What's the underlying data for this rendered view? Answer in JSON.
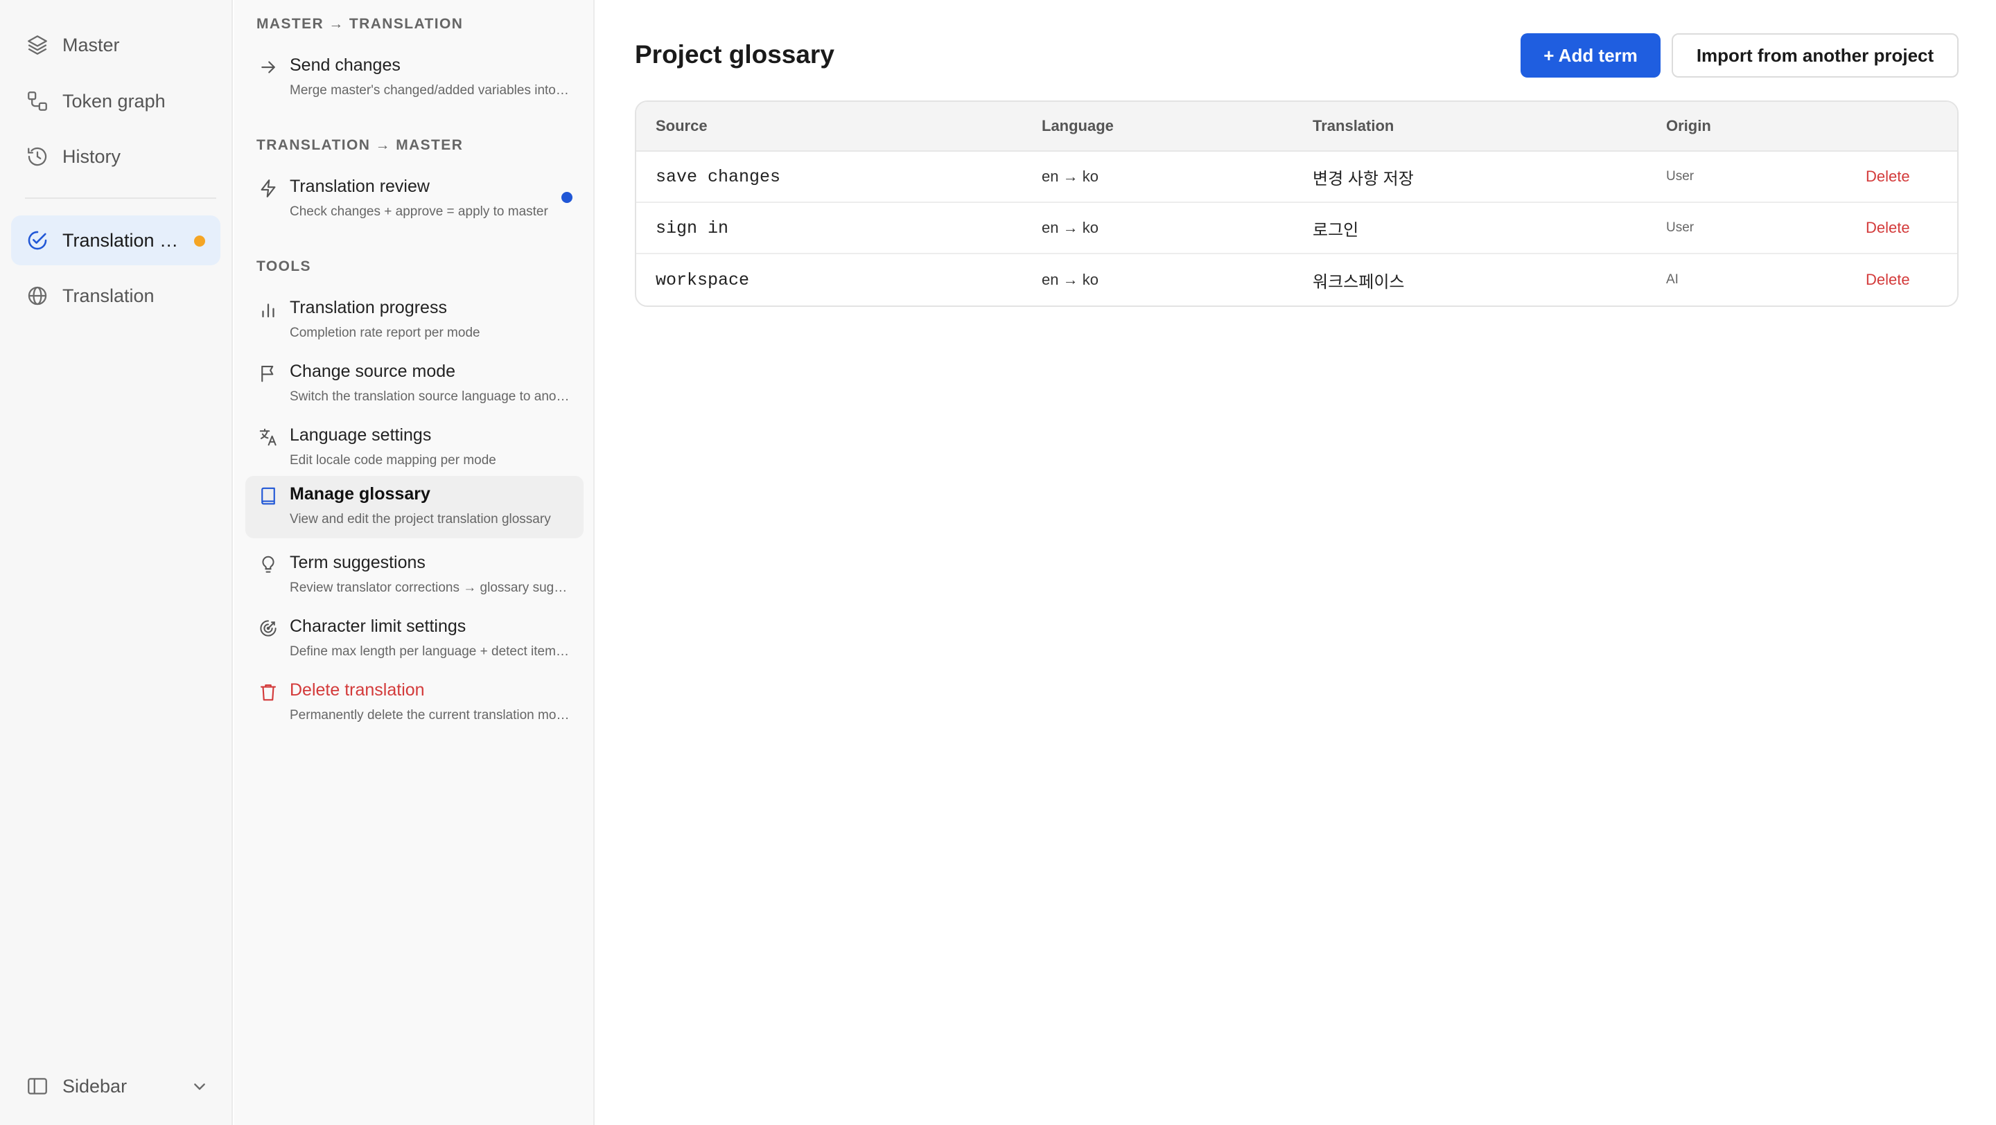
{
  "nav": {
    "items": [
      {
        "label": "Master",
        "icon": "layers-icon"
      },
      {
        "label": "Token graph",
        "icon": "graph-icon"
      },
      {
        "label": "History",
        "icon": "history-icon"
      },
      {
        "label": "Translation review",
        "icon": "check-circle-icon"
      },
      {
        "label": "Translation",
        "icon": "globe-icon"
      }
    ],
    "bottom_label": "Sidebar",
    "colors": {
      "active_bg": "#e6effb",
      "badge": "#f5a524"
    }
  },
  "panel": {
    "sections": [
      {
        "title": "MASTER → TRANSLATION"
      },
      {
        "title": "TRANSLATION → MASTER"
      },
      {
        "title": "TOOLS"
      }
    ],
    "tools": [
      {
        "title": "Send changes",
        "desc": "Merge master's changed/added variables into translation",
        "icon": "arrow-right-icon"
      },
      {
        "title": "Translation review",
        "desc": "Check changes + approve = apply to master",
        "icon": "lightning-icon"
      },
      {
        "title": "Translation progress",
        "desc": "Completion rate report per mode",
        "icon": "bar-chart-icon"
      },
      {
        "title": "Change source mode",
        "desc": "Switch the translation source language to another mode",
        "icon": "flag-icon"
      },
      {
        "title": "Language settings",
        "desc": "Edit locale code mapping per mode",
        "icon": "translate-icon"
      },
      {
        "title": "Manage glossary",
        "desc": "View and edit the project translation glossary",
        "icon": "book-icon"
      },
      {
        "title": "Term suggestions",
        "desc": "Review translator corrections → glossary suggestions",
        "icon": "lightbulb-icon"
      },
      {
        "title": "Character limit settings",
        "desc": "Define max length per language + detect items over limit",
        "icon": "target-icon"
      },
      {
        "title": "Delete translation",
        "desc": "Permanently delete the current translation mode",
        "icon": "trash-icon"
      }
    ],
    "colors": {
      "danger": "#d33a3a",
      "dot": "#2157d6"
    }
  },
  "main": {
    "title": "Project glossary",
    "add_label": "+ Add term",
    "import_label": "Import from another project",
    "colors": {
      "primary": "#1f5ee0"
    },
    "table": {
      "columns": [
        "Source",
        "Language",
        "Translation",
        "Origin"
      ],
      "rows": [
        {
          "source": "save changes",
          "language": "en → ko",
          "translation": "변경 사항 저장",
          "origin": "User",
          "action": "Delete"
        },
        {
          "source": "sign in",
          "language": "en → ko",
          "translation": "로그인",
          "origin": "User",
          "action": "Delete"
        },
        {
          "source": "workspace",
          "language": "en → ko",
          "translation": "워크스페이스",
          "origin": "AI",
          "action": "Delete"
        }
      ]
    }
  }
}
